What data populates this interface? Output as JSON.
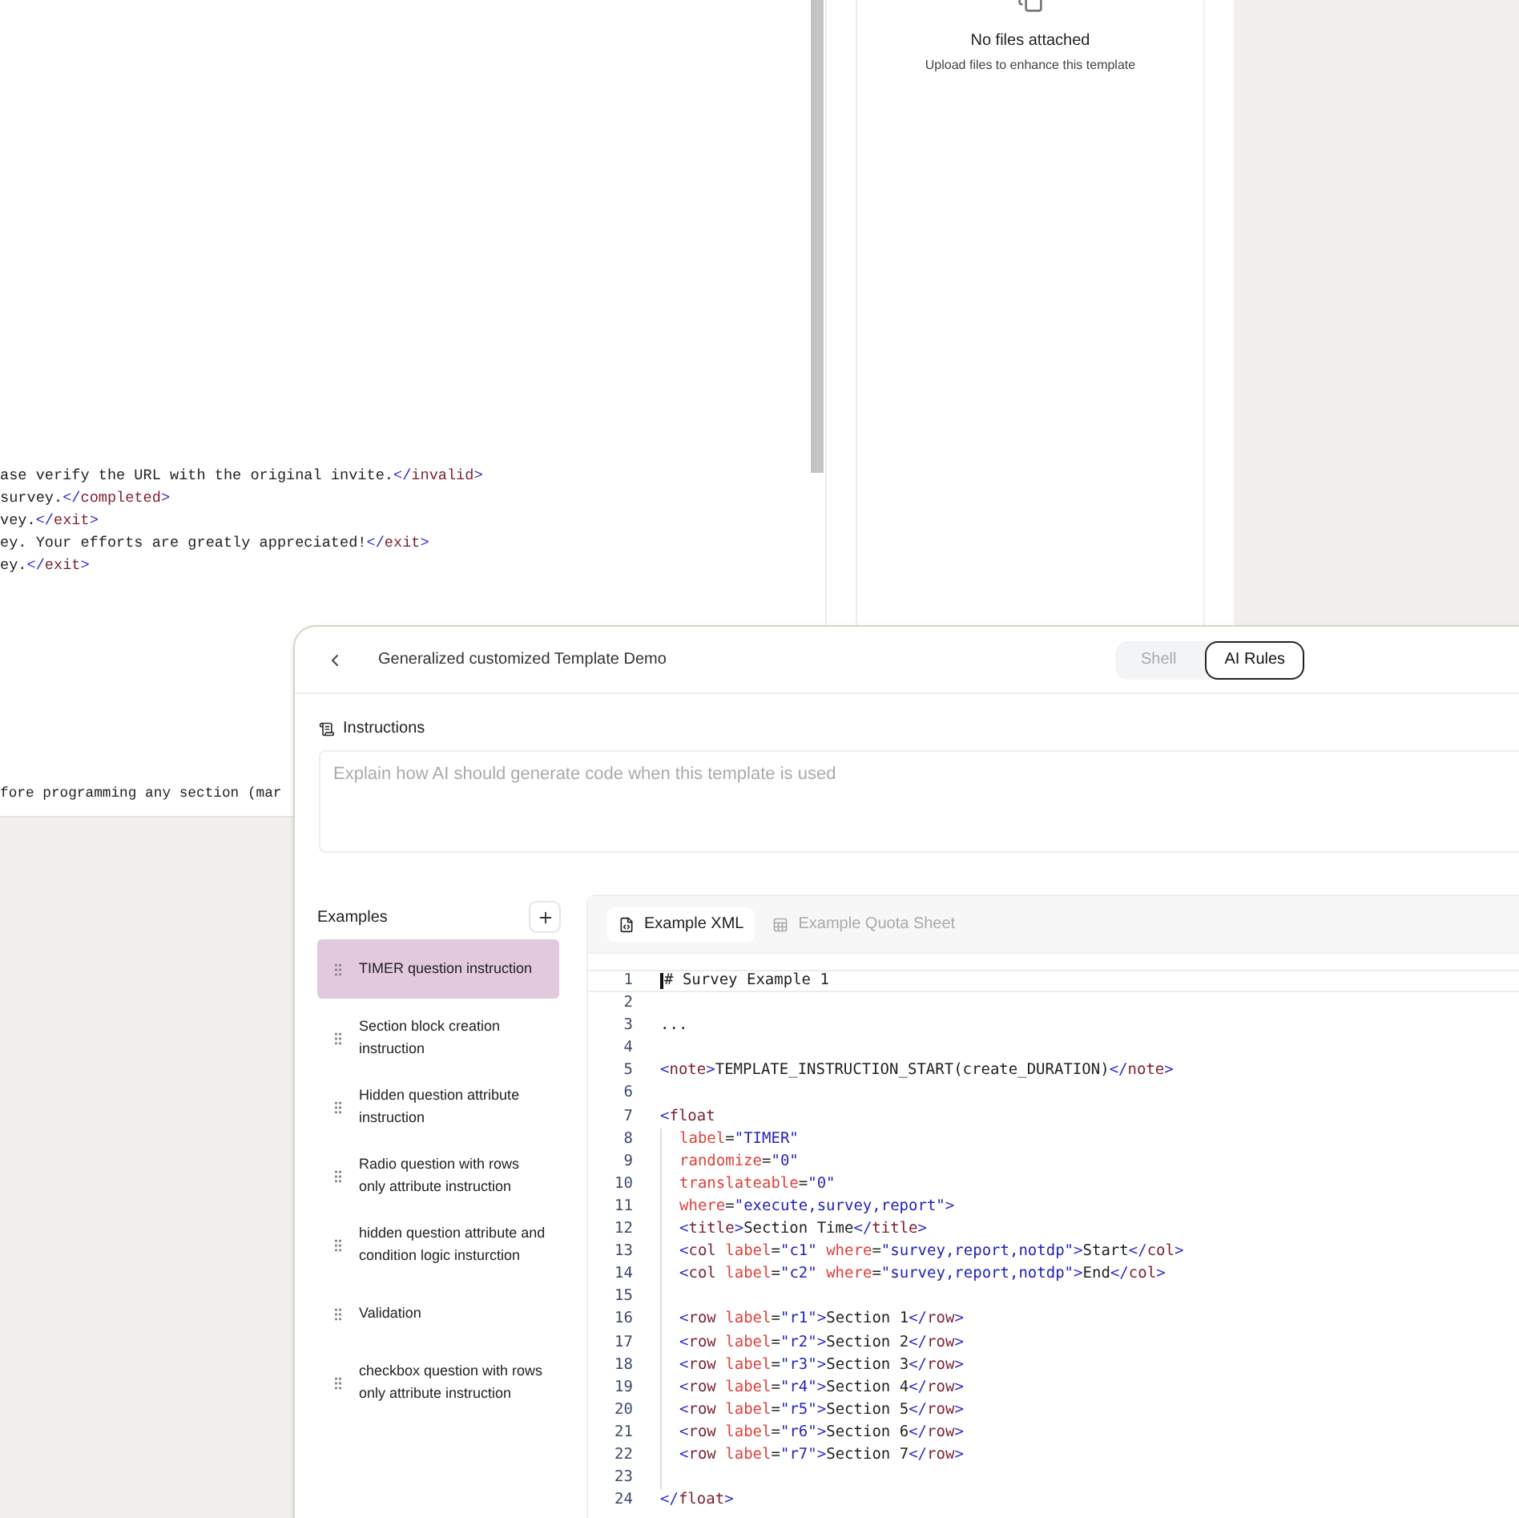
{
  "background": {
    "code_lines": [
      [
        {
          "kind": "text",
          "text": "ase verify the URL with the original invite."
        },
        {
          "kind": "punct",
          "text": "</"
        },
        {
          "kind": "tag",
          "text": "invalid"
        },
        {
          "kind": "punct",
          "text": ">"
        }
      ],
      [
        {
          "kind": "text",
          "text": "survey."
        },
        {
          "kind": "punct",
          "text": "</"
        },
        {
          "kind": "tag",
          "text": "completed"
        },
        {
          "kind": "punct",
          "text": ">"
        }
      ],
      [
        {
          "kind": "text",
          "text": "vey."
        },
        {
          "kind": "punct",
          "text": "</"
        },
        {
          "kind": "tag",
          "text": "exit"
        },
        {
          "kind": "punct",
          "text": ">"
        }
      ],
      [
        {
          "kind": "text",
          "text": "ey. Your efforts are greatly appreciated!"
        },
        {
          "kind": "punct",
          "text": "</"
        },
        {
          "kind": "tag",
          "text": "exit"
        },
        {
          "kind": "punct",
          "text": ">"
        }
      ],
      [
        {
          "kind": "text",
          "text": "ey."
        },
        {
          "kind": "punct",
          "text": "</"
        },
        {
          "kind": "tag",
          "text": "exit"
        },
        {
          "kind": "punct",
          "text": ">"
        }
      ]
    ],
    "cut_line": "fore programming any section (mar",
    "files_panel": {
      "title": "No files attached",
      "subtitle": "Upload files to enhance this template"
    }
  },
  "panel": {
    "title": "Generalized customized Template Demo",
    "mode_tabs": [
      {
        "label": "Shell",
        "selected": false
      },
      {
        "label": "AI Rules",
        "selected": true
      }
    ],
    "instructions": {
      "label": "Instructions",
      "placeholder": "Explain how AI should generate code when this template is used"
    },
    "examples": {
      "label": "Examples",
      "items": [
        {
          "label": "TIMER question instruction",
          "selected": true
        },
        {
          "label": "Section block creation instruction",
          "selected": false
        },
        {
          "label": "Hidden question attribute instruction",
          "selected": false
        },
        {
          "label": "Radio question with rows only attribute instruction",
          "selected": false
        },
        {
          "label": "hidden question attribute and condition logic insturction",
          "selected": false
        },
        {
          "label": "Validation",
          "selected": false
        },
        {
          "label": "checkbox question with rows only attribute instruction",
          "selected": false
        }
      ]
    },
    "editor_tabs": [
      {
        "label": "Example XML",
        "kind": "xml",
        "selected": true
      },
      {
        "label": "Example Quota Sheet",
        "kind": "sheet",
        "selected": false
      }
    ],
    "code_lines": [
      {
        "number": "1",
        "indented": false,
        "tokens": [
          {
            "kind": "text",
            "text": "# Survey Example 1"
          }
        ]
      },
      {
        "number": "2",
        "indented": false
      },
      {
        "number": "3",
        "indented": false,
        "tokens": [
          {
            "kind": "text",
            "text": "..."
          }
        ]
      },
      {
        "number": "4",
        "indented": false
      },
      {
        "number": "5",
        "indented": false,
        "tokens": [
          {
            "kind": "punct",
            "text": "<"
          },
          {
            "kind": "tag",
            "text": "note"
          },
          {
            "kind": "punct",
            "text": ">"
          },
          {
            "kind": "text",
            "text": "TEMPLATE_INSTRUCTION_START(create_DURATION)"
          },
          {
            "kind": "punct",
            "text": "</"
          },
          {
            "kind": "tag",
            "text": "note"
          },
          {
            "kind": "punct",
            "text": ">"
          }
        ]
      },
      {
        "number": "6",
        "indented": false
      },
      {
        "number": "7",
        "indented": false,
        "tokens": [
          {
            "kind": "punct",
            "text": "<"
          },
          {
            "kind": "tag",
            "text": "float"
          }
        ]
      },
      {
        "number": "8",
        "indented": true,
        "tokens": [
          {
            "kind": "attr",
            "text": "label"
          },
          {
            "kind": "text",
            "text": "="
          },
          {
            "kind": "string",
            "text": "\"TIMER\""
          }
        ]
      },
      {
        "number": "9",
        "indented": true,
        "tokens": [
          {
            "kind": "attr",
            "text": "randomize"
          },
          {
            "kind": "text",
            "text": "="
          },
          {
            "kind": "string",
            "text": "\"0\""
          }
        ]
      },
      {
        "number": "10",
        "indented": true,
        "tokens": [
          {
            "kind": "attr",
            "text": "translateable"
          },
          {
            "kind": "text",
            "text": "="
          },
          {
            "kind": "string",
            "text": "\"0\""
          }
        ]
      },
      {
        "number": "11",
        "indented": true,
        "tokens": [
          {
            "kind": "attr",
            "text": "where"
          },
          {
            "kind": "text",
            "text": "="
          },
          {
            "kind": "string",
            "text": "\"execute,survey,report\""
          },
          {
            "kind": "punct",
            "text": ">"
          }
        ]
      },
      {
        "number": "12",
        "indented": true,
        "tokens": [
          {
            "kind": "punct",
            "text": "<"
          },
          {
            "kind": "tag",
            "text": "title"
          },
          {
            "kind": "punct",
            "text": ">"
          },
          {
            "kind": "text",
            "text": "Section Time"
          },
          {
            "kind": "punct",
            "text": "</"
          },
          {
            "kind": "tag",
            "text": "title"
          },
          {
            "kind": "punct",
            "text": ">"
          }
        ]
      },
      {
        "number": "13",
        "indented": true,
        "tokens": [
          {
            "kind": "punct",
            "text": "<"
          },
          {
            "kind": "tag",
            "text": "col "
          },
          {
            "kind": "attr",
            "text": "label"
          },
          {
            "kind": "text",
            "text": "="
          },
          {
            "kind": "string",
            "text": "\"c1\" "
          },
          {
            "kind": "attr",
            "text": "where"
          },
          {
            "kind": "text",
            "text": "="
          },
          {
            "kind": "string",
            "text": "\"survey,report,notdp\""
          },
          {
            "kind": "punct",
            "text": ">"
          },
          {
            "kind": "text",
            "text": "Start"
          },
          {
            "kind": "punct",
            "text": "</"
          },
          {
            "kind": "tag",
            "text": "col"
          },
          {
            "kind": "punct",
            "text": ">"
          }
        ]
      },
      {
        "number": "14",
        "indented": true,
        "tokens": [
          {
            "kind": "punct",
            "text": "<"
          },
          {
            "kind": "tag",
            "text": "col "
          },
          {
            "kind": "attr",
            "text": "label"
          },
          {
            "kind": "text",
            "text": "="
          },
          {
            "kind": "string",
            "text": "\"c2\" "
          },
          {
            "kind": "attr",
            "text": "where"
          },
          {
            "kind": "text",
            "text": "="
          },
          {
            "kind": "string",
            "text": "\"survey,report,notdp\""
          },
          {
            "kind": "punct",
            "text": ">"
          },
          {
            "kind": "text",
            "text": "End"
          },
          {
            "kind": "punct",
            "text": "</"
          },
          {
            "kind": "tag",
            "text": "col"
          },
          {
            "kind": "punct",
            "text": ">"
          }
        ]
      },
      {
        "number": "15",
        "indented": true
      },
      {
        "number": "16",
        "indented": true,
        "tokens": [
          {
            "kind": "punct",
            "text": "<"
          },
          {
            "kind": "tag",
            "text": "row "
          },
          {
            "kind": "attr",
            "text": "label"
          },
          {
            "kind": "text",
            "text": "="
          },
          {
            "kind": "string",
            "text": "\"r1\""
          },
          {
            "kind": "punct",
            "text": ">"
          },
          {
            "kind": "text",
            "text": "Section 1"
          },
          {
            "kind": "punct",
            "text": "</"
          },
          {
            "kind": "tag",
            "text": "row"
          },
          {
            "kind": "punct",
            "text": ">"
          }
        ]
      },
      {
        "number": "17",
        "indented": true,
        "tokens": [
          {
            "kind": "punct",
            "text": "<"
          },
          {
            "kind": "tag",
            "text": "row "
          },
          {
            "kind": "attr",
            "text": "label"
          },
          {
            "kind": "text",
            "text": "="
          },
          {
            "kind": "string",
            "text": "\"r2\""
          },
          {
            "kind": "punct",
            "text": ">"
          },
          {
            "kind": "text",
            "text": "Section 2"
          },
          {
            "kind": "punct",
            "text": "</"
          },
          {
            "kind": "tag",
            "text": "row"
          },
          {
            "kind": "punct",
            "text": ">"
          }
        ]
      },
      {
        "number": "18",
        "indented": true,
        "tokens": [
          {
            "kind": "punct",
            "text": "<"
          },
          {
            "kind": "tag",
            "text": "row "
          },
          {
            "kind": "attr",
            "text": "label"
          },
          {
            "kind": "text",
            "text": "="
          },
          {
            "kind": "string",
            "text": "\"r3\""
          },
          {
            "kind": "punct",
            "text": ">"
          },
          {
            "kind": "text",
            "text": "Section 3"
          },
          {
            "kind": "punct",
            "text": "</"
          },
          {
            "kind": "tag",
            "text": "row"
          },
          {
            "kind": "punct",
            "text": ">"
          }
        ]
      },
      {
        "number": "19",
        "indented": true,
        "tokens": [
          {
            "kind": "punct",
            "text": "<"
          },
          {
            "kind": "tag",
            "text": "row "
          },
          {
            "kind": "attr",
            "text": "label"
          },
          {
            "kind": "text",
            "text": "="
          },
          {
            "kind": "string",
            "text": "\"r4\""
          },
          {
            "kind": "punct",
            "text": ">"
          },
          {
            "kind": "text",
            "text": "Section 4"
          },
          {
            "kind": "punct",
            "text": "</"
          },
          {
            "kind": "tag",
            "text": "row"
          },
          {
            "kind": "punct",
            "text": ">"
          }
        ]
      },
      {
        "number": "20",
        "indented": true,
        "tokens": [
          {
            "kind": "punct",
            "text": "<"
          },
          {
            "kind": "tag",
            "text": "row "
          },
          {
            "kind": "attr",
            "text": "label"
          },
          {
            "kind": "text",
            "text": "="
          },
          {
            "kind": "string",
            "text": "\"r5\""
          },
          {
            "kind": "punct",
            "text": ">"
          },
          {
            "kind": "text",
            "text": "Section 5"
          },
          {
            "kind": "punct",
            "text": "</"
          },
          {
            "kind": "tag",
            "text": "row"
          },
          {
            "kind": "punct",
            "text": ">"
          }
        ]
      },
      {
        "number": "21",
        "indented": true,
        "tokens": [
          {
            "kind": "punct",
            "text": "<"
          },
          {
            "kind": "tag",
            "text": "row "
          },
          {
            "kind": "attr",
            "text": "label"
          },
          {
            "kind": "text",
            "text": "="
          },
          {
            "kind": "string",
            "text": "\"r6\""
          },
          {
            "kind": "punct",
            "text": ">"
          },
          {
            "kind": "text",
            "text": "Section 6"
          },
          {
            "kind": "punct",
            "text": "</"
          },
          {
            "kind": "tag",
            "text": "row"
          },
          {
            "kind": "punct",
            "text": ">"
          }
        ]
      },
      {
        "number": "22",
        "indented": true,
        "tokens": [
          {
            "kind": "punct",
            "text": "<"
          },
          {
            "kind": "tag",
            "text": "row "
          },
          {
            "kind": "attr",
            "text": "label"
          },
          {
            "kind": "text",
            "text": "="
          },
          {
            "kind": "string",
            "text": "\"r7\""
          },
          {
            "kind": "punct",
            "text": ">"
          },
          {
            "kind": "text",
            "text": "Section 7"
          },
          {
            "kind": "punct",
            "text": "</"
          },
          {
            "kind": "tag",
            "text": "row"
          },
          {
            "kind": "punct",
            "text": ">"
          }
        ]
      },
      {
        "number": "23",
        "indented": true
      },
      {
        "number": "24",
        "indented": false,
        "tokens": [
          {
            "kind": "punct",
            "text": "</"
          },
          {
            "kind": "tag",
            "text": "float"
          },
          {
            "kind": "punct",
            "text": ">"
          }
        ]
      }
    ]
  }
}
